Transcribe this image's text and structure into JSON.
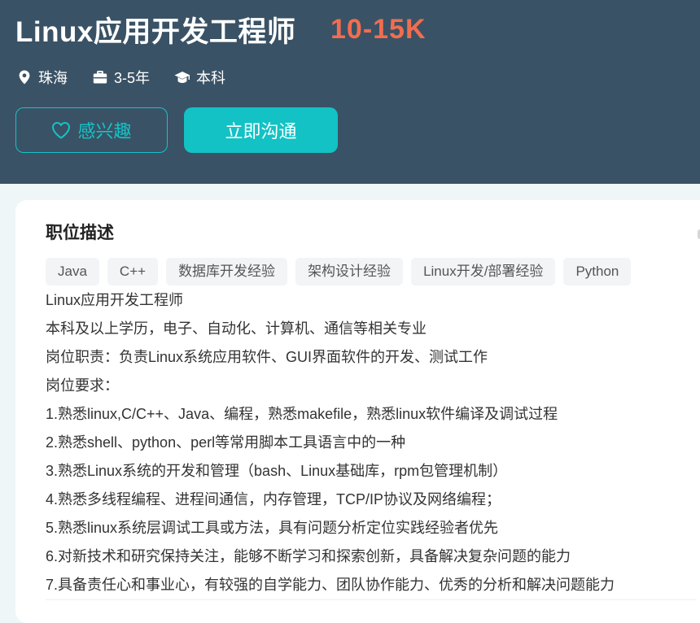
{
  "job": {
    "title": "Linux应用开发工程师",
    "salary": "10-15K",
    "meta": [
      {
        "icon": "location-pin-icon",
        "text": "珠海"
      },
      {
        "icon": "briefcase-icon",
        "text": "3-5年"
      },
      {
        "icon": "graduation-cap-icon",
        "text": "本科"
      }
    ]
  },
  "actions": {
    "interest_label": "感兴趣",
    "chat_label": "立即沟通"
  },
  "description": {
    "title": "职位描述",
    "tags": [
      "Java",
      "C++",
      "数据库开发经验",
      "架构设计经验",
      "Linux开发/部署经验",
      "Python"
    ],
    "lines": [
      "Linux应用开发工程师",
      "本科及以上学历，电子、自动化、计算机、通信等相关专业",
      "岗位职责：负责Linux系统应用软件、GUI界面软件的开发、测试工作",
      "岗位要求：",
      "1.熟悉linux,C/C++、Java、编程，熟悉makefile，熟悉linux软件编译及调试过程",
      "2.熟悉shell、python、perl等常用脚本工具语言中的一种",
      "3.熟悉Linux系统的开发和管理（bash、Linux基础库，rpm包管理机制）",
      "4.熟悉多线程编程、进程间通信，内存管理，TCP/IP协议及网络编程；",
      "5.熟悉linux系统层调试工具或方法，具有问题分析定位实践经验者优先",
      "6.对新技术和研究保持关注，能够不断学习和探索创新，具备解决复杂问题的能力",
      "7.具备责任心和事业心，有较强的自学能力、团队协作能力、优秀的分析和解决问题能力"
    ]
  },
  "colors": {
    "header_bg": "#3a5265",
    "salary": "#f26d4f",
    "accent": "#12c2c4"
  }
}
